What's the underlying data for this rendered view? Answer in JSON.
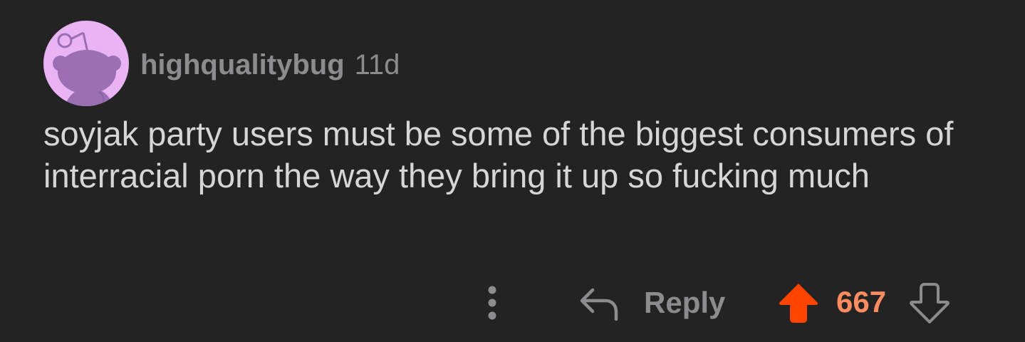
{
  "comment": {
    "username": "highqualitybug",
    "age": "11d",
    "text": "soyjak party users must be some of the biggest consumers of interracial porn the way they bring it up so fucking much"
  },
  "actions": {
    "more_icon": "vertical-ellipsis",
    "reply_icon": "reply-arrow",
    "reply_label": "Reply",
    "upvote_icon": "upvote-arrow-filled",
    "score": "667",
    "downvote_icon": "downvote-arrow-outline"
  },
  "colors": {
    "background": "#232324",
    "avatar_bg": "#e9b3f4",
    "avatar_figure": "#9a6fb4",
    "meta_text": "#8c8c8e",
    "body_text": "#d6d6d8",
    "upvote_active": "#ff4500",
    "score_active": "#ff8b60",
    "icon_gray": "#8c8c8e"
  }
}
